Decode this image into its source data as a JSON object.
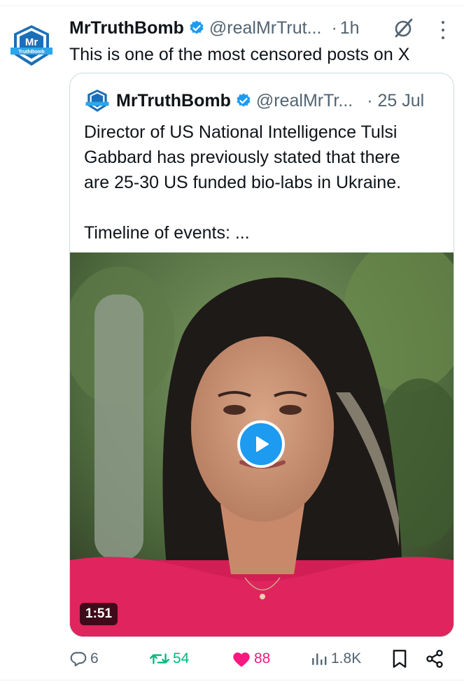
{
  "post": {
    "author_name": "MrTruthBomb",
    "author_handle": "@realMrTrut...",
    "separator": "·",
    "time": "1h",
    "avatar_text_main": "Mr",
    "avatar_text_ribbon": "TruthBomb",
    "text": "This is one of the most censored posts on X"
  },
  "quote": {
    "author_name": "MrTruthBomb",
    "author_handle": "@realMrTr...",
    "time": "· 25 Jul",
    "paragraph_lines": [
      "Director of US National Intelligence Tulsi",
      "Gabbard has previously stated that there",
      "are 25-30 US funded bio-labs in Ukraine."
    ],
    "timeline_text": "Timeline of events: ...",
    "video_duration": "1:51"
  },
  "actions": {
    "replies": "6",
    "reposts": "54",
    "likes": "88",
    "views": "1.8K"
  },
  "colors": {
    "verified": "#1d9bf0",
    "repost": "#00ba7c",
    "like": "#f91880",
    "secondary_text": "#536471"
  },
  "icons": [
    "verified-badge-icon",
    "grok-icon",
    "more-icon",
    "play-icon",
    "reply-icon",
    "repost-icon",
    "like-icon",
    "views-icon",
    "bookmark-icon",
    "share-icon"
  ]
}
